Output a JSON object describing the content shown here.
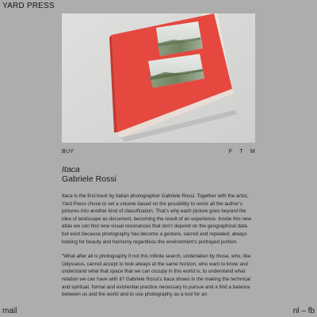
{
  "brand": "YARD PRESS",
  "book": {
    "title": "Itaca",
    "author": "Gabriele Rossi"
  },
  "actions": {
    "buy": "BUY",
    "share": [
      "F",
      "T",
      "M"
    ]
  },
  "description": {
    "p1_title": "Itaca",
    "p1_rest": " is the first book by Italian photographer Gabriele Rossi. Together with the artist, Yard Press chose to set a volume based on the possibility to remix all the author’s pictures into another kind of classification. That’s why each picture goes beyond the idea of landscape as document, becoming the result of an experience. Inside this new atlas we can find new visual resonances that don’t depend on the geographical data but exist because photography has become a gesture, sacred and repeated, always looking for beauty and harmony regardless the environment’s portrayed portion.",
    "p2": "“What after all is photography if not this infinite search, undertaken by those, who, like Odysseus, cannot accept to look always at the same horizon, who want to know and understand what that space that we can occupy in this world is, to understand what relation we can have with it? Gabriele Rossi’s Itaca shows in the making the technical and spiritual, formal and existential practice necessary to pursue and a find a balance between us and the world and to use photography as a tool for an"
  },
  "footer": {
    "mail": "mail",
    "lang": "nl",
    "separator": "–",
    "fb": "fb"
  },
  "colors": {
    "background": "#adadad",
    "cover_red": "#e5483f",
    "photo_background": "#d7d8d6"
  }
}
